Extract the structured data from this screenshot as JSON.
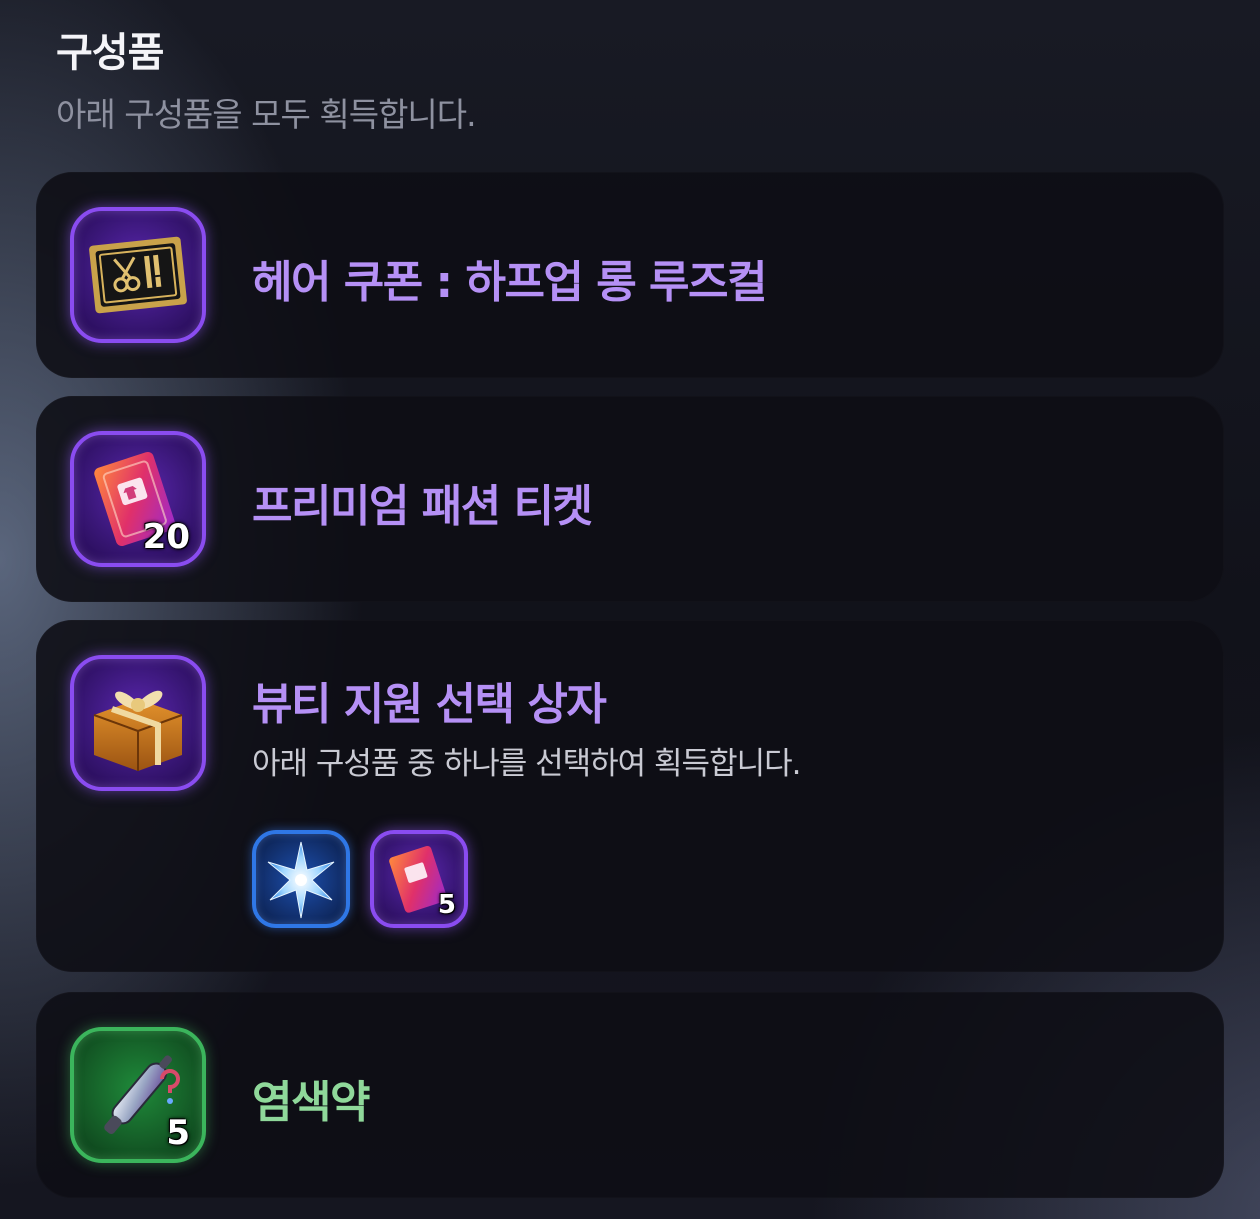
{
  "header": {
    "title": "구성품",
    "subtitle": "아래 구성품을 모두 획득합니다."
  },
  "items": [
    {
      "name": "헤어 쿠폰 : 하프업 롱 루즈컬",
      "icon": "hair-coupon-icon",
      "quantity": null,
      "grade_color": "#8a4cf0"
    },
    {
      "name": "프리미엄 패션 티켓",
      "icon": "fashion-ticket-icon",
      "quantity": "20",
      "grade_color": "#8a4cf0"
    },
    {
      "name": "뷰티 지원 선택 상자",
      "icon": "gift-box-icon",
      "quantity": null,
      "grade_color": "#8a4cf0",
      "description": "아래 구성품 중 하나를 선택하여 획득합니다.",
      "choices": [
        {
          "icon": "star-crystal-icon",
          "quantity": null,
          "grade_color": "#2f77e6"
        },
        {
          "icon": "fashion-ticket-icon",
          "quantity": "5",
          "grade_color": "#8a4cf0"
        }
      ]
    },
    {
      "name": "염색약",
      "icon": "dye-icon",
      "quantity": "5",
      "grade_color": "#3bb55c"
    }
  ]
}
